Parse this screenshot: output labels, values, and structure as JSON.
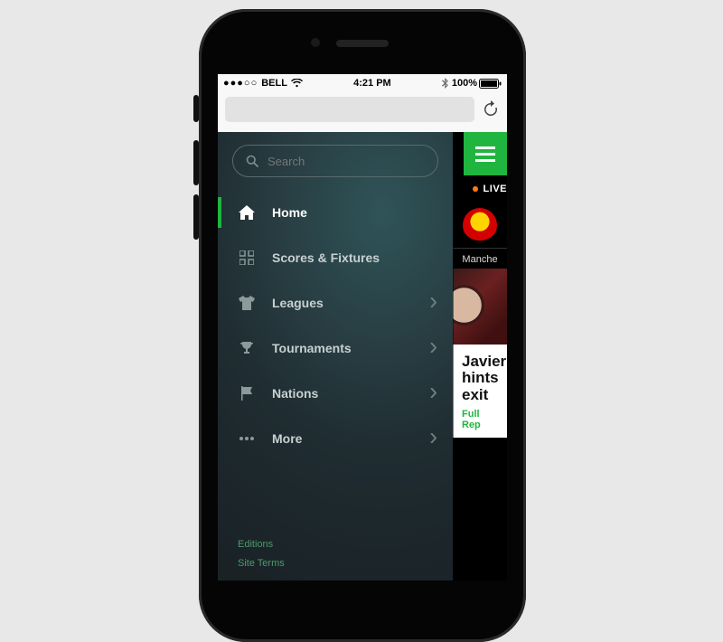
{
  "status_bar": {
    "carrier": "BELL",
    "time": "4:21 PM",
    "battery": "100%"
  },
  "search": {
    "placeholder": "Search"
  },
  "nav": {
    "items": [
      {
        "label": "Home"
      },
      {
        "label": "Scores & Fixtures"
      },
      {
        "label": "Leagues"
      },
      {
        "label": "Tournaments"
      },
      {
        "label": "Nations"
      },
      {
        "label": "More"
      }
    ]
  },
  "footer": {
    "editions": "Editions",
    "site_terms": "Site Terms"
  },
  "page": {
    "live_label": "LIVE",
    "team_name_fragment": "Manche",
    "article_title_fragment": "Javier\nhints\nexit",
    "article_link_fragment": "Full Rep"
  }
}
